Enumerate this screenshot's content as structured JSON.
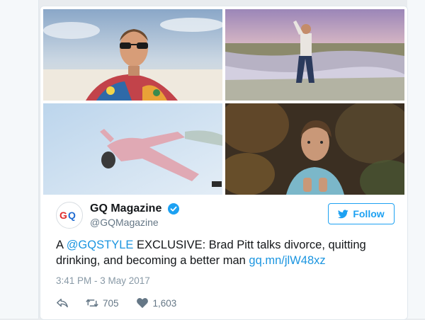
{
  "account": {
    "display_name": "GQ Magazine",
    "handle": "@GQMagazine",
    "avatar_text": "GQ",
    "verified_icon": "verified-badge-icon"
  },
  "follow": {
    "label": "Follow",
    "icon": "twitter-bird-icon"
  },
  "tweet": {
    "mention": "@GQSTYLE",
    "text_prefix": "A ",
    "text_body": " EXCLUSIVE: Brad Pitt talks divorce, quitting drinking, and becoming a better man ",
    "link": "gq.mn/jlW48xz"
  },
  "timestamp": "3:41 PM - 3 May 2017",
  "actions": {
    "reply_icon": "reply-icon",
    "retweet_icon": "retweet-icon",
    "retweet_count": "705",
    "like_icon": "heart-icon",
    "like_count": "1,603"
  },
  "colors": {
    "accent": "#1da1f2",
    "link": "#1b95e0",
    "text": "#14171a",
    "muted": "#657786",
    "logo_red": "#e02b2b",
    "logo_blue": "#1f6bd1"
  }
}
